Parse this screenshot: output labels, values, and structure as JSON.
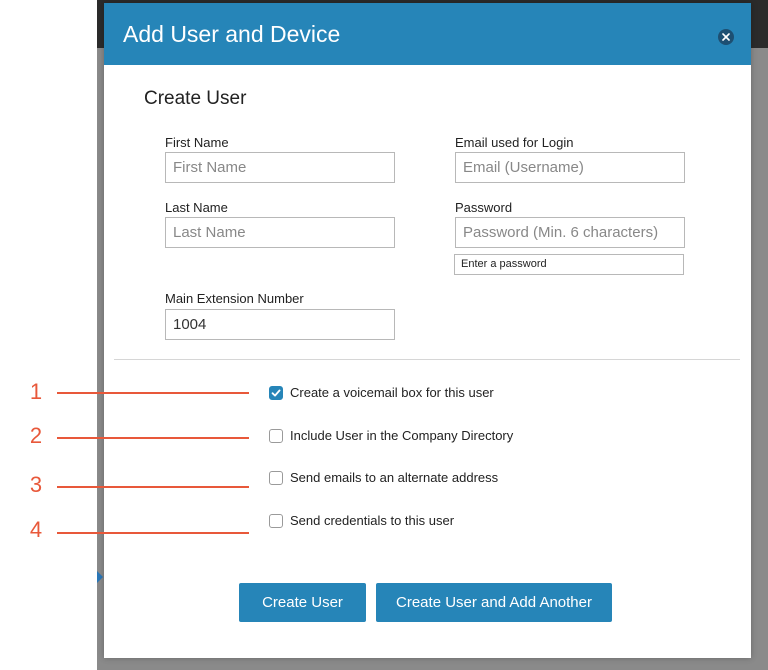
{
  "modal": {
    "title": "Add User and Device",
    "section_title": "Create User"
  },
  "fields": {
    "first_name": {
      "label": "First Name",
      "placeholder": "First Name",
      "value": ""
    },
    "last_name": {
      "label": "Last Name",
      "placeholder": "Last Name",
      "value": ""
    },
    "email": {
      "label": "Email used for Login",
      "placeholder": "Email (Username)",
      "value": ""
    },
    "password": {
      "label": "Password",
      "placeholder": "Password (Min. 6 characters)",
      "value": "",
      "hint": "Enter a password"
    },
    "extension": {
      "label": "Main Extension Number",
      "placeholder": "",
      "value": "1004"
    }
  },
  "options": [
    {
      "label": "Create a voicemail box for this user",
      "checked": true
    },
    {
      "label": "Include User in the Company Directory",
      "checked": false
    },
    {
      "label": "Send emails to an alternate address",
      "checked": false
    },
    {
      "label": "Send credentials to this user",
      "checked": false
    }
  ],
  "buttons": {
    "create": "Create User",
    "create_another": "Create User and Add Another"
  },
  "callouts": [
    "1",
    "2",
    "3",
    "4"
  ],
  "colors": {
    "header": "#2685b8",
    "button": "#2685b8",
    "callout": "#e8583a"
  }
}
